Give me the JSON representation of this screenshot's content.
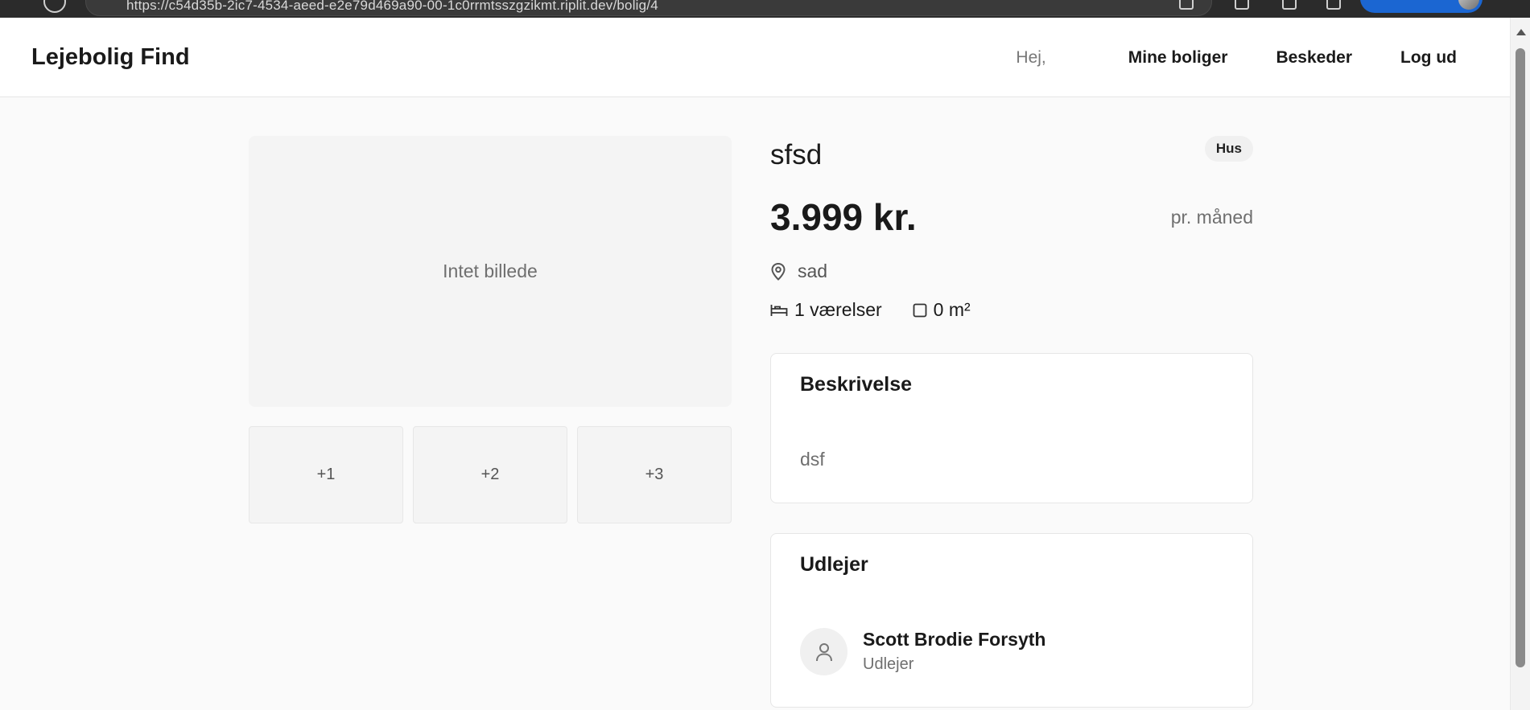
{
  "browser": {
    "url": "https://c54d35b-2ic7-4534-aeed-e2e79d469a90-00-1c0rrmtsszgzikmt.riplit.dev/bolig/4"
  },
  "header": {
    "logo": "Lejebolig Find",
    "greeting": "Hej,",
    "nav": {
      "my_homes": "Mine boliger",
      "messages": "Beskeder",
      "logout": "Log ud"
    }
  },
  "gallery": {
    "main_placeholder": "Intet billede",
    "thumbnails": [
      "+1",
      "+2",
      "+3"
    ]
  },
  "listing": {
    "title": "sfsd",
    "type_badge": "Hus",
    "price": "3.999 kr.",
    "price_period": "pr. måned",
    "location": "sad",
    "rooms": "1 værelser",
    "area": "0 m²"
  },
  "description_card": {
    "heading": "Beskrivelse",
    "text": "dsf"
  },
  "landlord_card": {
    "heading": "Udlejer",
    "name": "Scott Brodie Forsyth",
    "role": "Udlejer"
  },
  "icons": {
    "location": "map-pin-icon",
    "rooms": "bed-icon",
    "area": "square-icon",
    "avatar": "user-icon"
  },
  "colors": {
    "page_bg": "#fafafa",
    "card_bg": "#ffffff",
    "muted_text": "#6f6f6f"
  }
}
